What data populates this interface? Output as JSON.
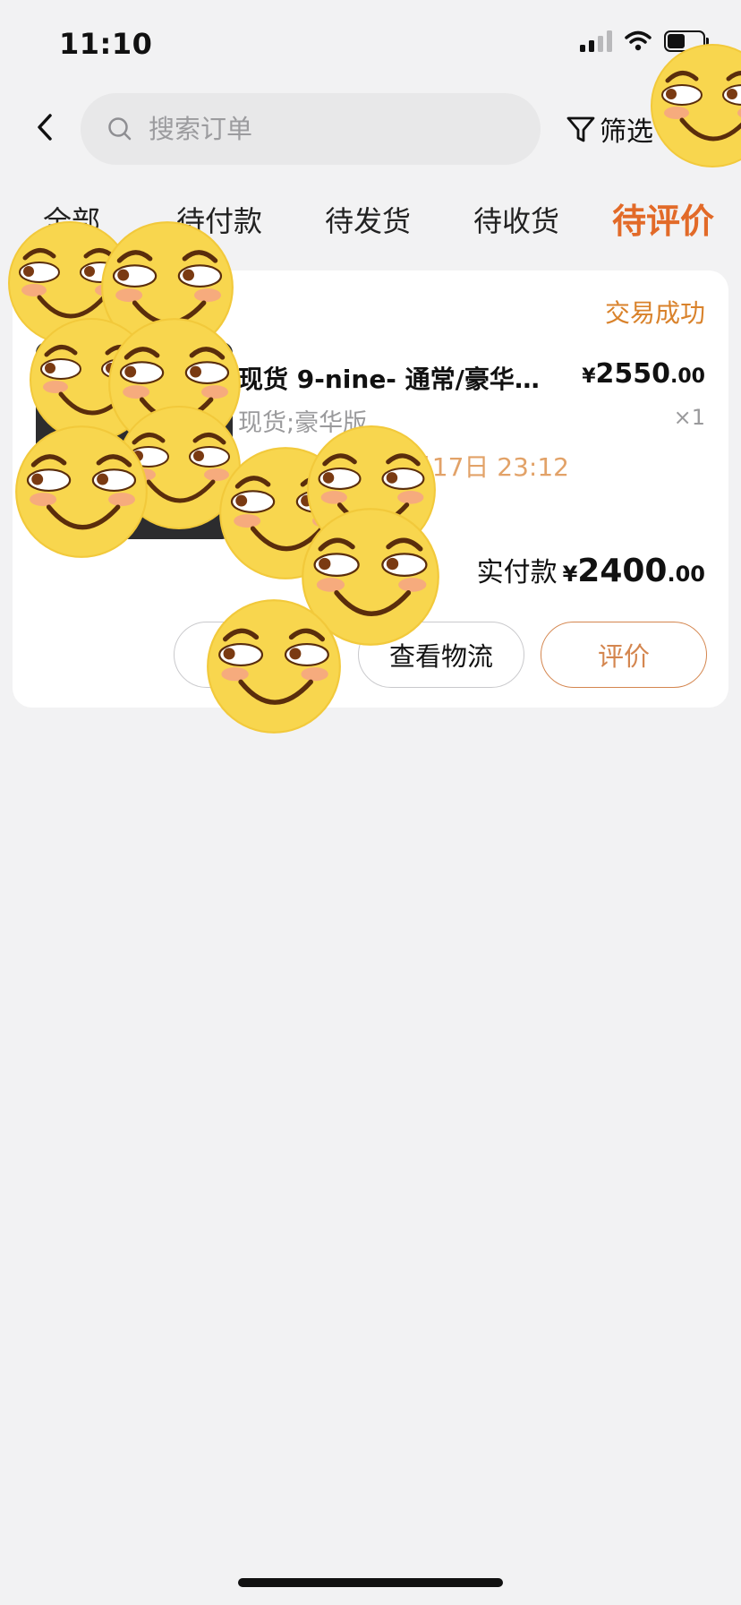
{
  "status_bar": {
    "time": "11:10"
  },
  "search": {
    "placeholder": "搜索订单"
  },
  "filter": {
    "label": "筛选"
  },
  "tabs": [
    {
      "label": "全部",
      "active": false
    },
    {
      "label": "待付款",
      "active": false
    },
    {
      "label": "待发货",
      "active": false
    },
    {
      "label": "待收货",
      "active": false
    },
    {
      "label": "待评价",
      "active": true
    }
  ],
  "order": {
    "status": "交易成功",
    "product": {
      "title": "现货 9-nine- 通常/豪华…",
      "spec": "现货;豪华版",
      "price_symbol": "¥",
      "price_int": "2550",
      "price_dec": ".00",
      "quantity": "×1"
    },
    "time": "月17日 23:12",
    "paid": {
      "label": "实付款",
      "symbol": "¥",
      "int": "2400",
      "dec": ".00"
    },
    "buttons": {
      "first": "卖",
      "logistics": "查看物流",
      "review": "评价"
    }
  },
  "colors": {
    "accent": "#e26a28",
    "status": "#d9822b",
    "background": "#f2f2f3"
  },
  "icons": [
    "back-chevron-icon",
    "search-icon",
    "filter-icon",
    "wifi-icon",
    "cellular-signal-icon",
    "battery-icon"
  ]
}
